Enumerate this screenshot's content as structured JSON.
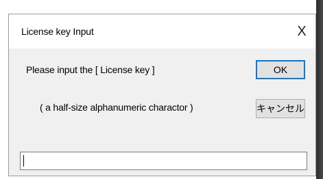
{
  "dialog": {
    "title": "License key  Input",
    "close_glyph": "X",
    "prompt": "Please input the [ License key ]",
    "hint": "( a half-size alphanumeric charactor )",
    "ok_label": "OK",
    "cancel_label": "キャンセル",
    "input_value": ""
  },
  "icons": {
    "close": "close-icon"
  }
}
